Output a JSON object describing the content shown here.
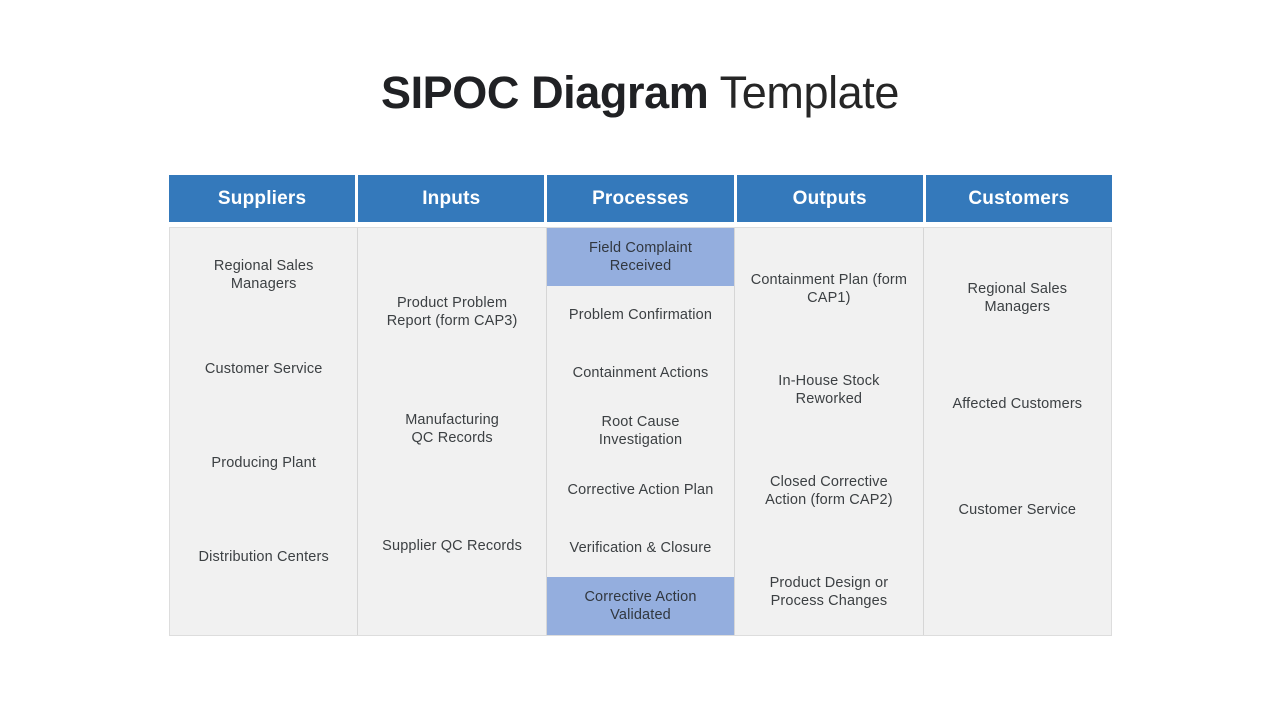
{
  "title": {
    "strong": "SIPOC Diagram",
    "light": " Template"
  },
  "colors": {
    "header_blue": "#3479bb",
    "highlight_blue": "#94aede",
    "cell_background": "#f1f1f1",
    "text": "#3c4043",
    "title_text": "#202124"
  },
  "table": {
    "columns": [
      {
        "key": "suppliers",
        "header": "Suppliers",
        "items": [
          {
            "text": "Regional Sales\nManagers",
            "highlight": false
          },
          {
            "text": "Customer Service",
            "highlight": false
          },
          {
            "text": "Producing Plant",
            "highlight": false
          },
          {
            "text": "Distribution Centers",
            "highlight": false
          }
        ]
      },
      {
        "key": "inputs",
        "header": "Inputs",
        "items": [
          {
            "text": "Product Problem\nReport (form CAP3)",
            "highlight": false
          },
          {
            "text": "Manufacturing\nQC Records",
            "highlight": false
          },
          {
            "text": "Supplier QC Records",
            "highlight": false
          }
        ]
      },
      {
        "key": "processes",
        "header": "Processes",
        "items": [
          {
            "text": "Field Complaint\nReceived",
            "highlight": true
          },
          {
            "text": "Problem Confirmation",
            "highlight": false
          },
          {
            "text": "Containment Actions",
            "highlight": false
          },
          {
            "text": "Root Cause\nInvestigation",
            "highlight": false
          },
          {
            "text": "Corrective Action Plan",
            "highlight": false
          },
          {
            "text": "Verification & Closure",
            "highlight": false
          },
          {
            "text": "Corrective Action\nValidated",
            "highlight": true
          }
        ]
      },
      {
        "key": "outputs",
        "header": "Outputs",
        "items": [
          {
            "text": "Containment Plan (form\nCAP1)",
            "highlight": false
          },
          {
            "text": "In-House Stock\nReworked",
            "highlight": false
          },
          {
            "text": "Closed Corrective\nAction (form CAP2)",
            "highlight": false
          },
          {
            "text": "Product Design or\nProcess Changes",
            "highlight": false
          }
        ]
      },
      {
        "key": "customers",
        "header": "Customers",
        "items": [
          {
            "text": "Regional Sales\nManagers",
            "highlight": false
          },
          {
            "text": "Affected Customers",
            "highlight": false
          },
          {
            "text": "Customer Service",
            "highlight": false
          }
        ]
      }
    ]
  }
}
